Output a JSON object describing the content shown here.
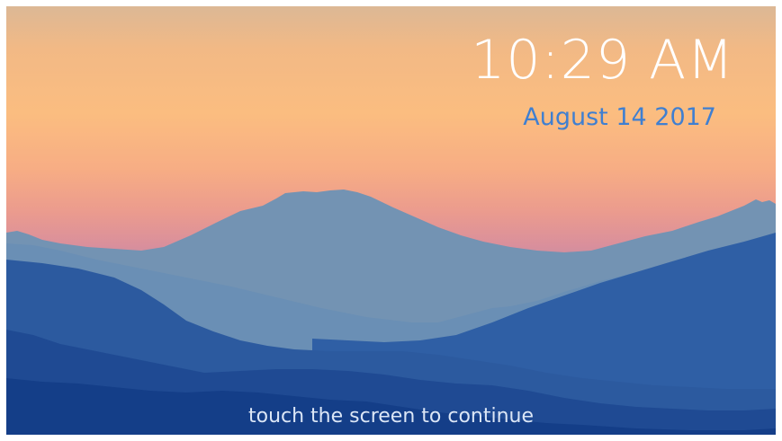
{
  "lock_screen": {
    "time": "10:29 AM",
    "date": "August 14 2017",
    "prompt": "touch the screen to continue"
  },
  "colors": {
    "time_text": "#ffffff",
    "date_text": "#3f7fd1",
    "prompt_text": "#dbe6f6",
    "sky_top": "#dcb895",
    "sky_mid": "#fbbd80",
    "sky_horizon": "#d98f9c",
    "mountain_far": "#7393b3",
    "mountain_mid": "#6a8fb5",
    "mountain_near": "#2f5fa5",
    "mountain_front": "#143e88"
  },
  "background": {
    "description_icon": "mountain-landscape-wallpaper"
  }
}
